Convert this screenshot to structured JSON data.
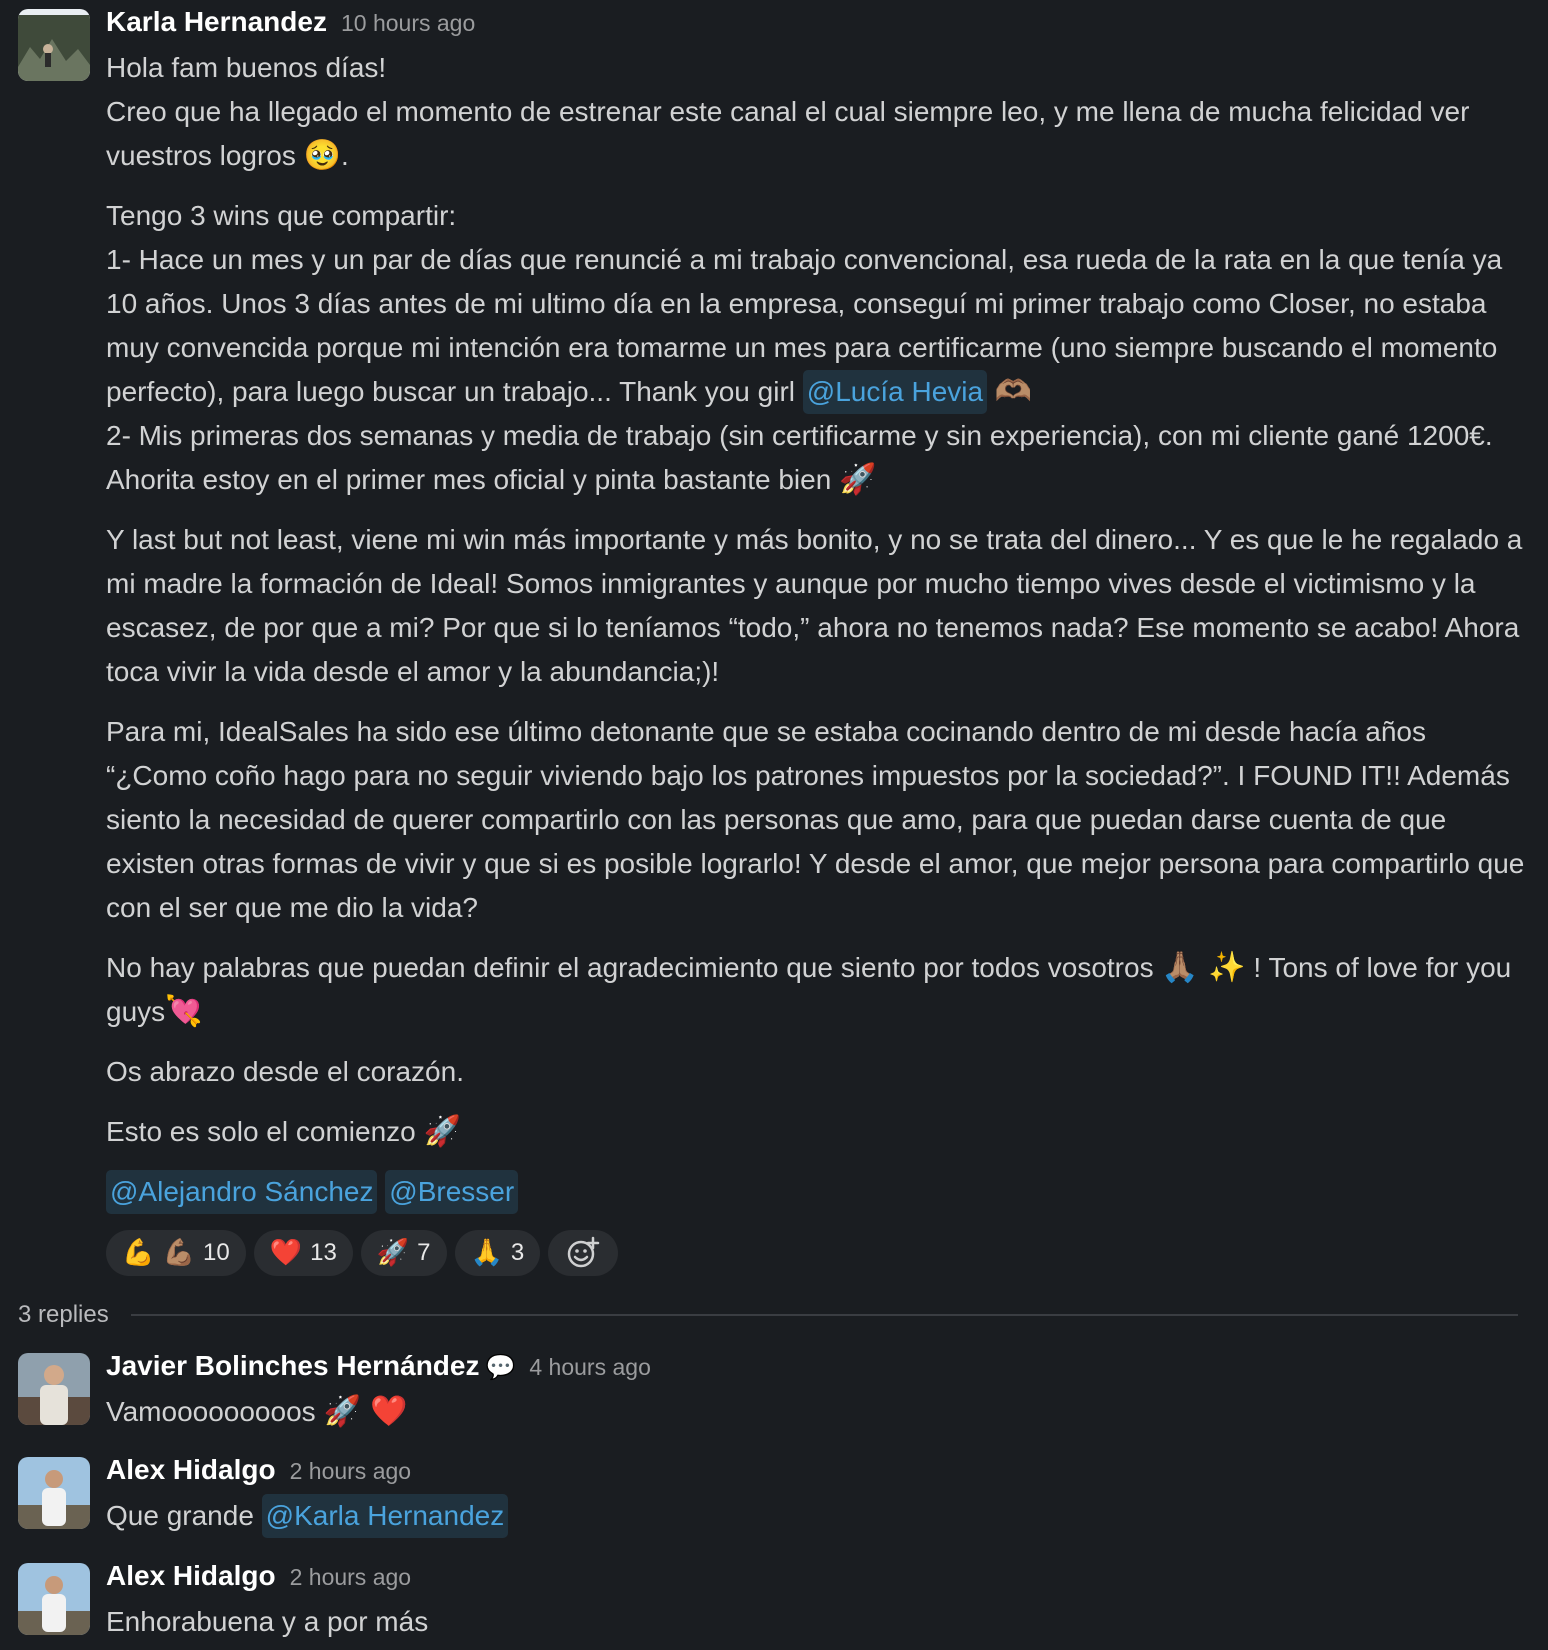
{
  "main_message": {
    "author": "Karla Hernandez",
    "time": "10 hours ago",
    "avatar_icon": "landscape-avatar",
    "lines": {
      "l1": "Hola fam buenos días!",
      "l2a": "Creo que ha llegado el momento de estrenar este canal el cual siempre leo, y me llena de mucha felicidad ver vuestros logros",
      "l2_emoji": "🥹",
      "l2b": ".",
      "p2_l1": "Tengo 3 wins que compartir:",
      "p2_l2": "1- Hace un mes y un par de días que renuncié a mi trabajo convencional, esa rueda de la rata en la que tenía ya 10 años. Unos 3 días antes de mi ultimo día en la empresa, conseguí mi primer trabajo como Closer, no estaba muy convencida porque mi intención era tomarme un mes para certificarme (uno siempre buscando el momento perfecto), para luego buscar un trabajo... Thank you girl",
      "p2_mention": "@Lucía Hevia",
      "p2_emoji": "🫶🏽",
      "p2_l3": "2- Mis primeras dos semanas y media de trabajo (sin certificarme y sin experiencia), con mi cliente gané 1200€. Ahorita estoy en el primer mes oficial y pinta bastante bien",
      "p2_l3_emoji": "🚀",
      "p3": "Y last but not least, viene mi win más importante y más bonito, y no se trata del dinero... Y es que le he regalado a mi madre la formación de Ideal! Somos inmigrantes y aunque por mucho tiempo vives desde el victimismo y la escasez, de por que a mi? Por que si lo teníamos “todo,” ahora no tenemos nada? Ese momento se acabo! Ahora toca vivir la vida desde el amor y la abundancia;)!",
      "p4": "Para mi, IdealSales ha sido ese último detonante que se estaba cocinando dentro de mi desde hacía años “¿Como coño hago para no seguir viviendo bajo los patrones impuestos por la sociedad?”. I FOUND IT!! Además siento la necesidad de querer compartirlo con las personas que amo, para que puedan darse cuenta de que existen otras formas de vivir y que si es posible lograrlo! Y desde el amor, que mejor persona para compartirlo que con el ser que me dio la vida?",
      "p5a": "No hay palabras que puedan definir el agradecimiento que siento por todos vosotros",
      "p5_emoji": "🙏🏽 ✨",
      "p5b": "! Tons of love for you guys",
      "p5_emoji2": "💘",
      "p6": "Os abrazo desde el corazón.",
      "p7": "Esto es solo el comienzo",
      "p7_emoji": "🚀",
      "mention1": "@Alejandro Sánchez",
      "mention2": "@Bresser"
    },
    "reactions": [
      {
        "emoji": "💪 💪🏽",
        "count": "10"
      },
      {
        "emoji": "❤️",
        "count": "13"
      },
      {
        "emoji": "🚀",
        "count": "7"
      },
      {
        "emoji": "🙏",
        "count": "3"
      }
    ]
  },
  "replies_label": "3 replies",
  "replies": [
    {
      "author": "Javier Bolinches Hernández",
      "status_emoji": "💬",
      "time": "4 hours ago",
      "text": "Vamooooooooos",
      "emoji": "🚀 ❤️"
    },
    {
      "author": "Alex Hidalgo",
      "time": "2 hours ago",
      "text": "Que grande",
      "mention": "@Karla Hernandez"
    },
    {
      "author": "Alex Hidalgo",
      "time": "2 hours ago",
      "text": "Enhorabuena y a por más"
    }
  ]
}
